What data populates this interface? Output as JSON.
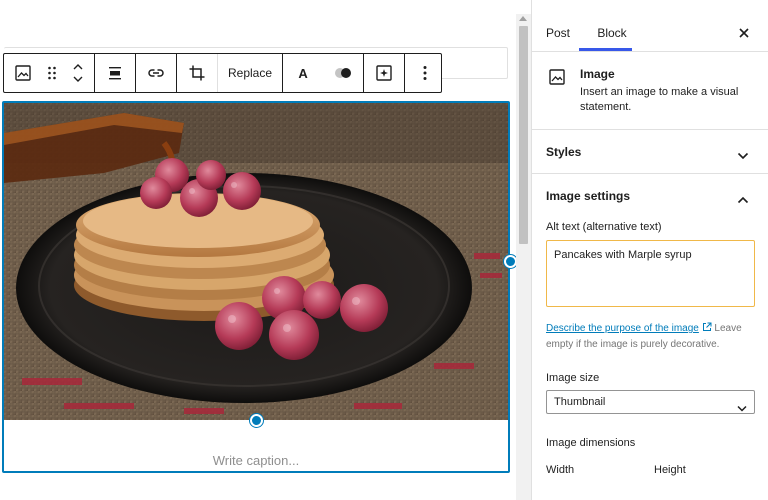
{
  "toolbar": {
    "replace_label": "Replace",
    "text_label": "A"
  },
  "image": {
    "caption_placeholder": "Write caption..."
  },
  "sidebar": {
    "tabs": [
      {
        "label": "Post",
        "active": false
      },
      {
        "label": "Block",
        "active": true
      }
    ],
    "block_card": {
      "title": "Image",
      "description": "Insert an image to make a visual statement."
    },
    "panels": {
      "styles": "Styles",
      "image_settings": "Image settings"
    },
    "alt_text": {
      "label": "Alt text (alternative text)",
      "value": "Pancakes with Marple syrup",
      "help_link": "Describe the purpose of the image",
      "help_text": " Leave empty if the image is purely decorative."
    },
    "image_size": {
      "label": "Image size",
      "selected": "Thumbnail"
    },
    "image_dimensions": {
      "label": "Image dimensions",
      "width_label": "Width",
      "height_label": "Height"
    }
  },
  "colors": {
    "accent": "#007cba",
    "tab_indicator": "#3858e9",
    "focus_outline": "#f0b849"
  }
}
